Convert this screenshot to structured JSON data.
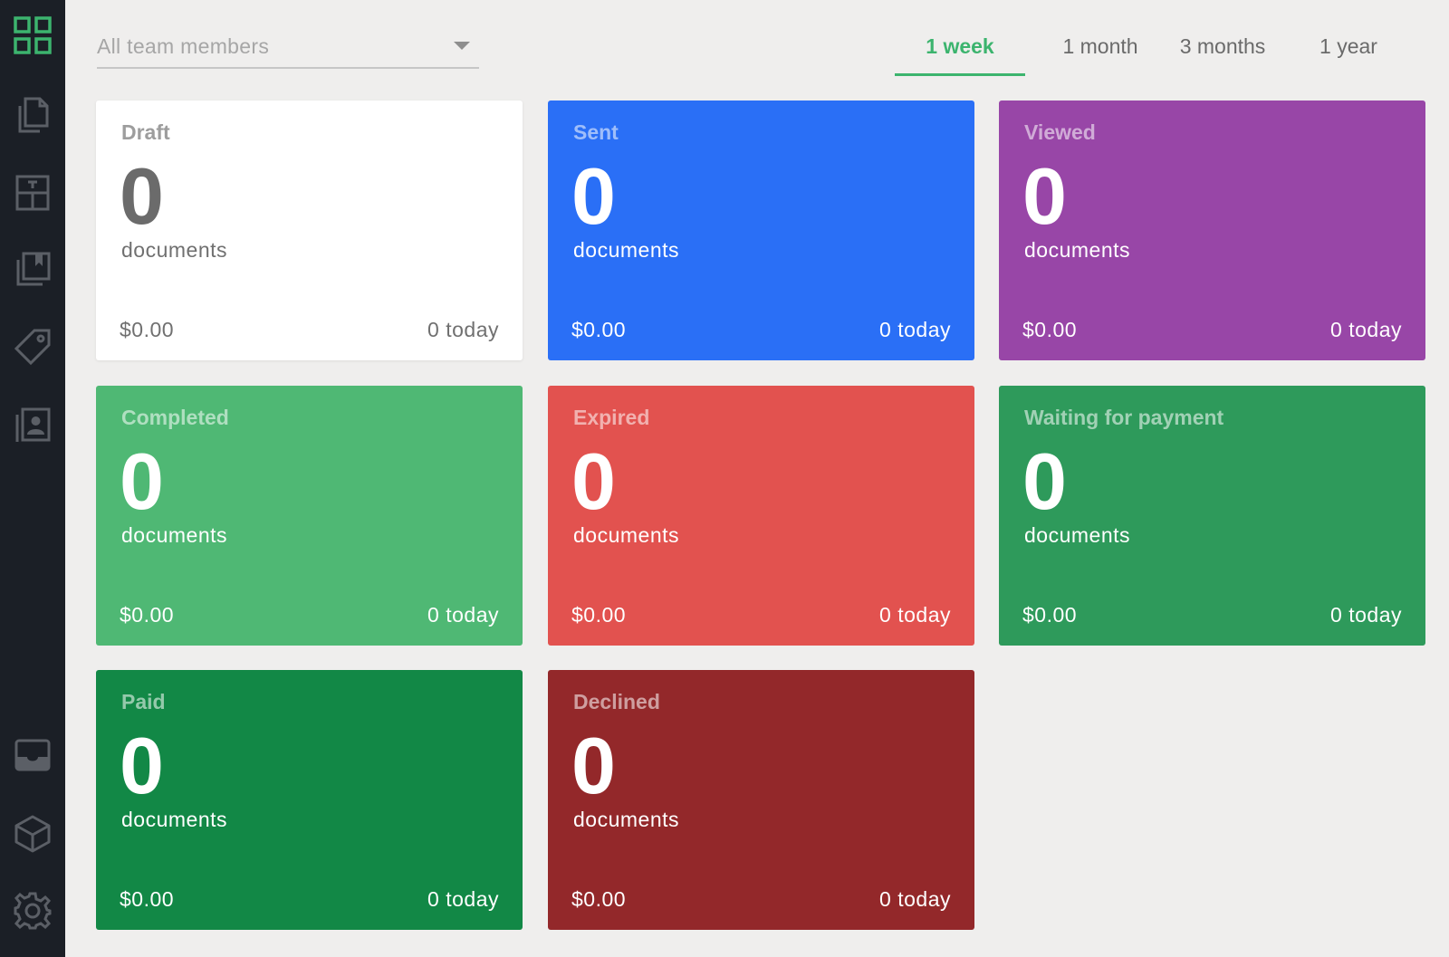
{
  "sidebar": {
    "items": [
      {
        "icon": "dashboard-grid-icon"
      },
      {
        "icon": "documents-icon"
      },
      {
        "icon": "templates-icon"
      },
      {
        "icon": "content-library-icon"
      },
      {
        "icon": "catalog-tag-icon"
      },
      {
        "icon": "contacts-icon"
      },
      {
        "icon": "inbox-icon"
      },
      {
        "icon": "integrations-cube-icon"
      },
      {
        "icon": "settings-gear-icon"
      }
    ],
    "accent_color": "#3cb46e"
  },
  "filter": {
    "label": "All team members"
  },
  "tabs": [
    {
      "label": "1 week",
      "active": true
    },
    {
      "label": "1 month",
      "active": false
    },
    {
      "label": "3 months",
      "active": false
    },
    {
      "label": "1 year",
      "active": false
    }
  ],
  "cards": [
    {
      "title": "Draft",
      "count": "0",
      "unit": "documents",
      "amount": "$0.00",
      "today": "0 today",
      "color": "#ffffff"
    },
    {
      "title": "Sent",
      "count": "0",
      "unit": "documents",
      "amount": "$0.00",
      "today": "0 today",
      "color": "#2a6ff6"
    },
    {
      "title": "Viewed",
      "count": "0",
      "unit": "documents",
      "amount": "$0.00",
      "today": "0 today",
      "color": "#9846a7"
    },
    {
      "title": "Completed",
      "count": "0",
      "unit": "documents",
      "amount": "$0.00",
      "today": "0 today",
      "color": "#4fb874"
    },
    {
      "title": "Expired",
      "count": "0",
      "unit": "documents",
      "amount": "$0.00",
      "today": "0 today",
      "color": "#e2524f"
    },
    {
      "title": "Waiting for payment",
      "count": "0",
      "unit": "documents",
      "amount": "$0.00",
      "today": "0 today",
      "color": "#2e9a5b"
    },
    {
      "title": "Paid",
      "count": "0",
      "unit": "documents",
      "amount": "$0.00",
      "today": "0 today",
      "color": "#128846"
    },
    {
      "title": "Declined",
      "count": "0",
      "unit": "documents",
      "amount": "$0.00",
      "today": "0 today",
      "color": "#93282a"
    }
  ]
}
